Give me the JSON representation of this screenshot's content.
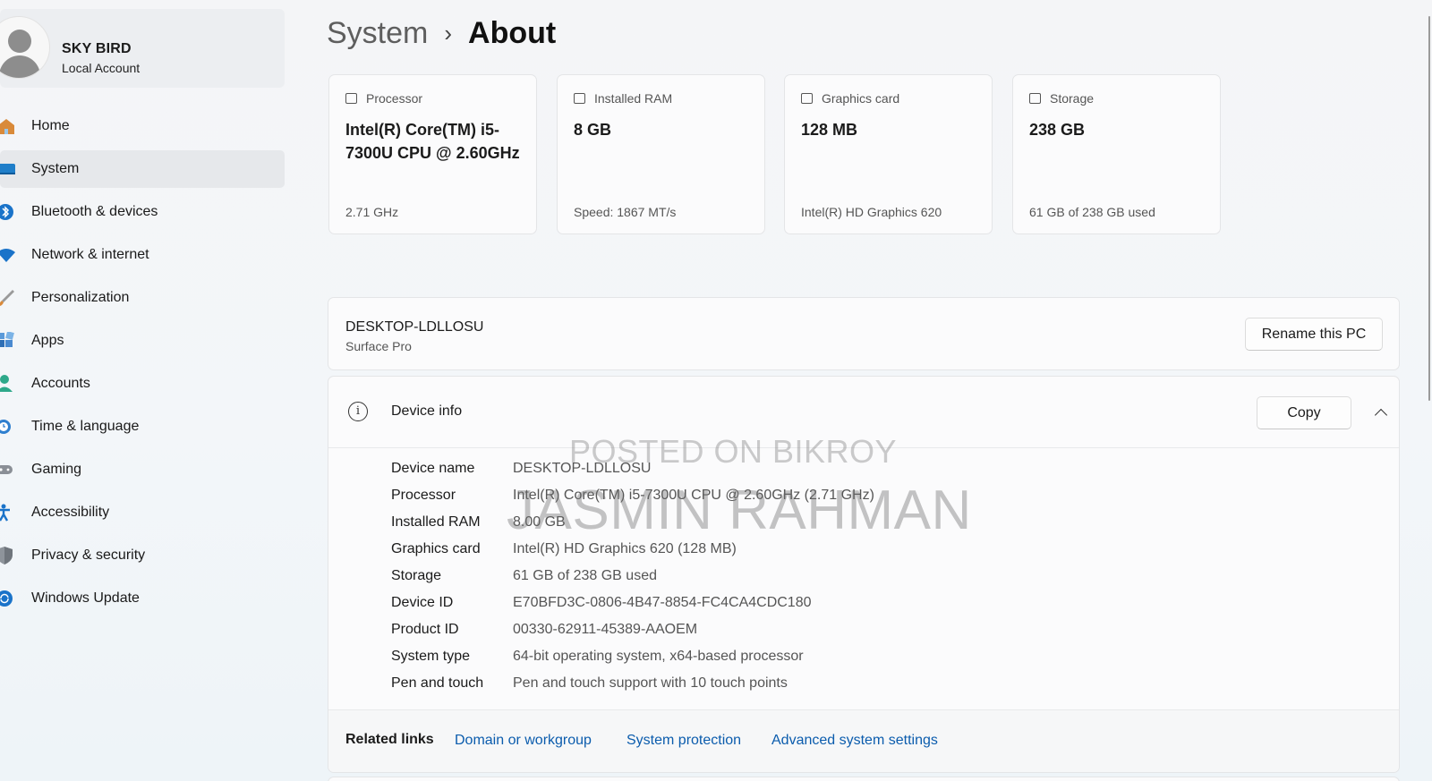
{
  "profile": {
    "name": "SKY BIRD",
    "account_type": "Local Account"
  },
  "sidebar": {
    "items": [
      {
        "label": "Home",
        "icon": "home-icon",
        "active": false
      },
      {
        "label": "System",
        "icon": "system-icon",
        "active": true
      },
      {
        "label": "Bluetooth & devices",
        "icon": "bluetooth-icon",
        "active": false
      },
      {
        "label": "Network & internet",
        "icon": "wifi-icon",
        "active": false
      },
      {
        "label": "Personalization",
        "icon": "brush-icon",
        "active": false
      },
      {
        "label": "Apps",
        "icon": "apps-icon",
        "active": false
      },
      {
        "label": "Accounts",
        "icon": "person-icon",
        "active": false
      },
      {
        "label": "Time & language",
        "icon": "clock-globe-icon",
        "active": false
      },
      {
        "label": "Gaming",
        "icon": "gamepad-icon",
        "active": false
      },
      {
        "label": "Accessibility",
        "icon": "accessibility-icon",
        "active": false
      },
      {
        "label": "Privacy & security",
        "icon": "shield-icon",
        "active": false
      },
      {
        "label": "Windows Update",
        "icon": "update-icon",
        "active": false
      }
    ]
  },
  "header": {
    "parent": "System",
    "separator": "›",
    "current": "About"
  },
  "cards": [
    {
      "caption": "Processor",
      "icon": "processor-icon",
      "value": "Intel(R) Core(TM) i5-7300U CPU @ 2.60GHz",
      "footer": "2.71 GHz"
    },
    {
      "caption": "Installed RAM",
      "icon": "ram-icon",
      "value": "8 GB",
      "footer": "Speed: 1867 MT/s"
    },
    {
      "caption": "Graphics card",
      "icon": "graphics-card-icon",
      "value": "128 MB",
      "footer": "Intel(R) HD Graphics 620"
    },
    {
      "caption": "Storage",
      "icon": "storage-icon",
      "value": "238 GB",
      "footer": "61 GB of 238 GB used"
    }
  ],
  "pc": {
    "name": "DESKTOP-LDLLOSU",
    "model": "Surface Pro",
    "rename_label": "Rename this PC"
  },
  "device_info": {
    "title": "Device info",
    "copy_label": "Copy",
    "rows": [
      {
        "key": "Device name",
        "value": "DESKTOP-LDLLOSU"
      },
      {
        "key": "Processor",
        "value": "Intel(R) Core(TM) i5-7300U CPU @ 2.60GHz (2.71 GHz)"
      },
      {
        "key": "Installed RAM",
        "value": "8.00 GB"
      },
      {
        "key": "Graphics card",
        "value": "Intel(R) HD Graphics 620 (128 MB)"
      },
      {
        "key": "Storage",
        "value": "61 GB of 238 GB used"
      },
      {
        "key": "Device ID",
        "value": "E70BFD3C-0806-4B47-8854-FC4CA4CDC180"
      },
      {
        "key": "Product ID",
        "value": "00330-62911-45389-AAOEM"
      },
      {
        "key": "System type",
        "value": "64-bit operating system, x64-based processor"
      },
      {
        "key": "Pen and touch",
        "value": "Pen and touch support with 10 touch points"
      }
    ]
  },
  "related": {
    "label": "Related links",
    "links": [
      "Domain or workgroup",
      "System protection",
      "Advanced system settings"
    ]
  },
  "watermark": {
    "line1": "POSTED ON BIKROY",
    "line2": "JASMIN RAHMAN"
  },
  "colors": {
    "accent": "#0b5cad",
    "active_item_bg": "#e6e8eb",
    "card_bg": "#fbfbfc"
  }
}
